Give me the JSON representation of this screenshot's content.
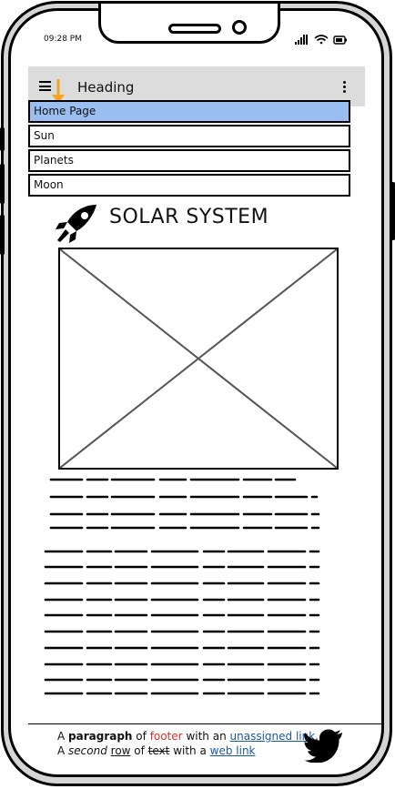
{
  "status_bar": {
    "time": "09:28 PM"
  },
  "app_bar": {
    "title": "Heading",
    "menu_icon": "hamburger-icon",
    "more_icon": "kebab-icon"
  },
  "menu": {
    "items": [
      {
        "label": "Home Page",
        "selected": true
      },
      {
        "label": "Sun"
      },
      {
        "label": "Planets"
      },
      {
        "label": "Moon"
      }
    ]
  },
  "content": {
    "title": "SOLAR SYSTEM",
    "title_icon": "rocket-icon",
    "image": "image-placeholder"
  },
  "footer": {
    "line1": {
      "a": "A ",
      "b": "paragraph",
      "c": " of ",
      "d": "footer",
      "e": " with an ",
      "f": "unassigned link",
      "g": "."
    },
    "line2": {
      "a": "A ",
      "b": "second",
      "c": " ",
      "d": "row",
      "e": " of ",
      "f": "text",
      "g": " with a ",
      "h": "web link"
    },
    "icon": "twitter-bird-icon"
  },
  "colors": {
    "selected_item": "#9bbef0",
    "appbar": "#dcdcdc",
    "link": "#1a5aa8",
    "accent_red": "#e32a2a",
    "cursor_arrow": "#f5a623"
  }
}
